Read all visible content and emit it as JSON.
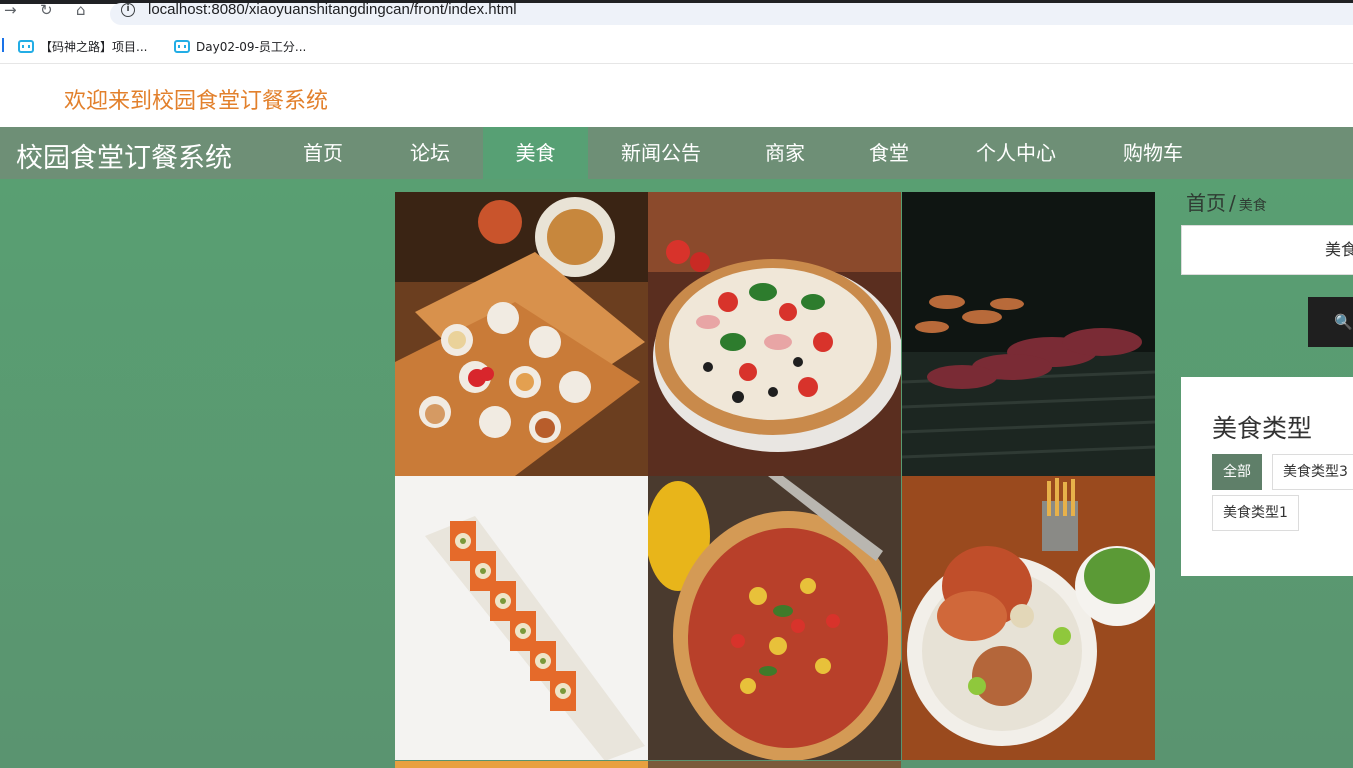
{
  "browser": {
    "url": "localhost:8080/xiaoyuanshitangdingcan/front/index.html",
    "bookmarks": [
      {
        "label": "【码神之路】项目..."
      },
      {
        "label": "Day02-09-员工分..."
      }
    ]
  },
  "header": {
    "welcome": "欢迎来到校园食堂订餐系统"
  },
  "nav": {
    "site_title": "校园食堂订餐系统",
    "items": [
      {
        "label": "首页"
      },
      {
        "label": "论坛"
      },
      {
        "label": "美食"
      },
      {
        "label": "新闻公告"
      },
      {
        "label": "商家"
      },
      {
        "label": "食堂"
      },
      {
        "label": "个人中心"
      },
      {
        "label": "购物车"
      }
    ],
    "active": "美食"
  },
  "breadcrumb": {
    "home": "首页",
    "separator": "/",
    "current": "美食"
  },
  "search": {
    "placeholder": "美食"
  },
  "category": {
    "title": "美食类型",
    "tags": [
      {
        "label": "全部",
        "active": true
      },
      {
        "label": "美食类型3",
        "active": false
      },
      {
        "label": "美食类型1",
        "active": false
      }
    ]
  },
  "food_items": [
    {
      "icon": "bento-box-image"
    },
    {
      "icon": "pizza-image"
    },
    {
      "icon": "grilled-meat-image"
    },
    {
      "icon": "sushi-roll-image"
    },
    {
      "icon": "pizza-image"
    },
    {
      "icon": "seafood-platter-image"
    }
  ],
  "colors": {
    "navbar": "#6e8f76",
    "nav_active": "#57a074",
    "main_bg": "#599f72",
    "welcome_text": "#e2802c",
    "tag_active": "#5f7f69"
  }
}
